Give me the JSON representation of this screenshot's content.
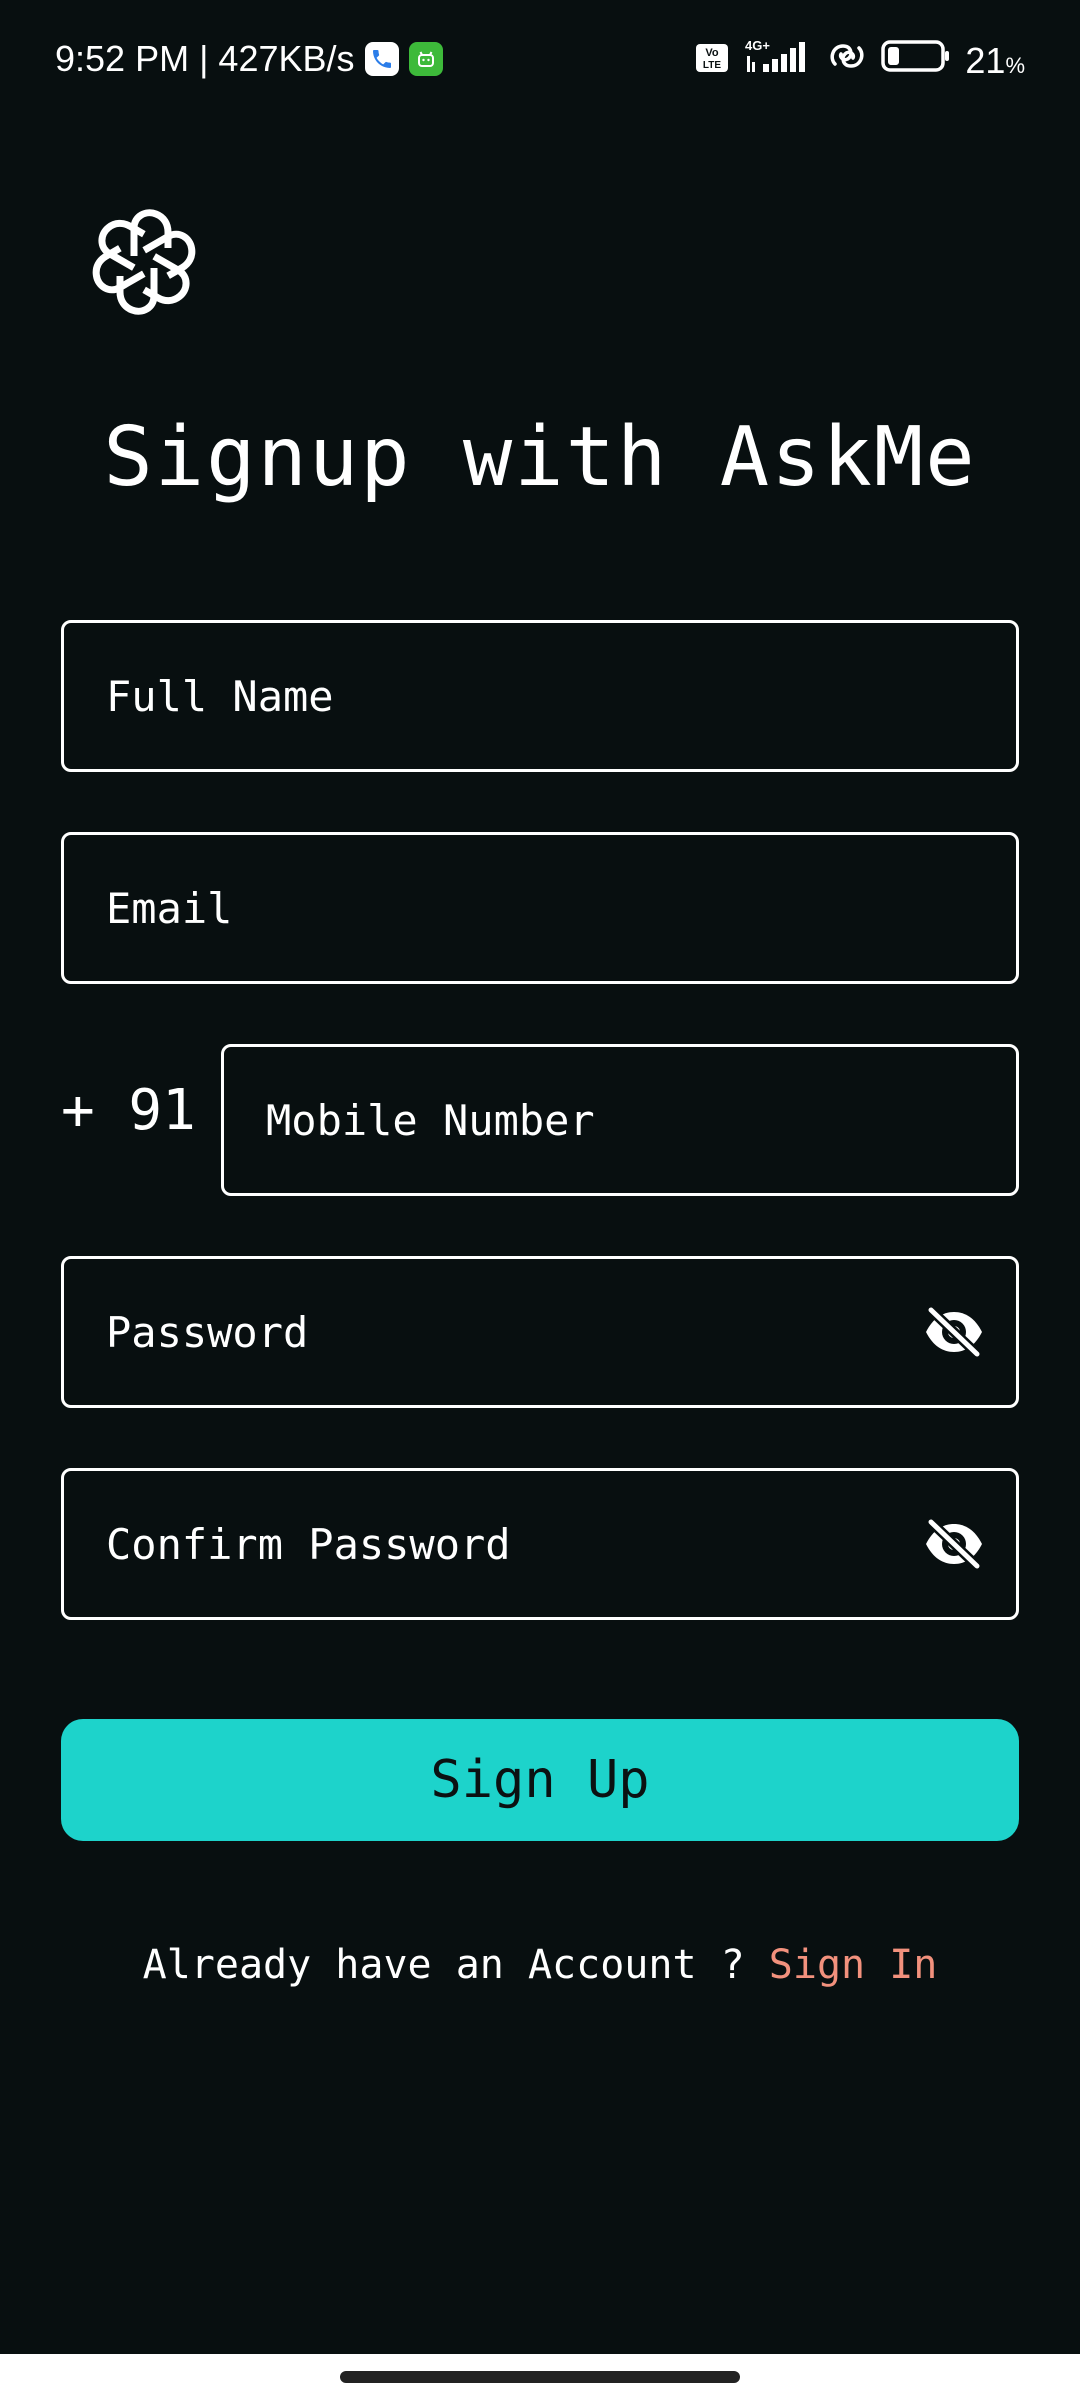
{
  "status_bar": {
    "time_speed": "9:52 PM | 427KB/s",
    "network": "4G+",
    "volte": "Vo LTE",
    "battery_pct": "21",
    "battery_unit": "%",
    "battery_level": 0.21
  },
  "header": {
    "title": "Signup with AskMe"
  },
  "form": {
    "full_name_placeholder": "Full Name",
    "email_placeholder": "Email",
    "country_code": "+ 91",
    "mobile_placeholder": "Mobile Number",
    "password_placeholder": "Password",
    "confirm_password_placeholder": "Confirm Password",
    "signup_label": "Sign Up"
  },
  "footer": {
    "prompt": "Already have an Account ? ",
    "signin_label": "Sign In"
  },
  "colors": {
    "background": "#080f10",
    "accent": "#1dd3cb",
    "link": "#f2917d"
  },
  "icons": {
    "logo": "openai-logo-icon",
    "password_toggle": "eye-off-icon"
  }
}
